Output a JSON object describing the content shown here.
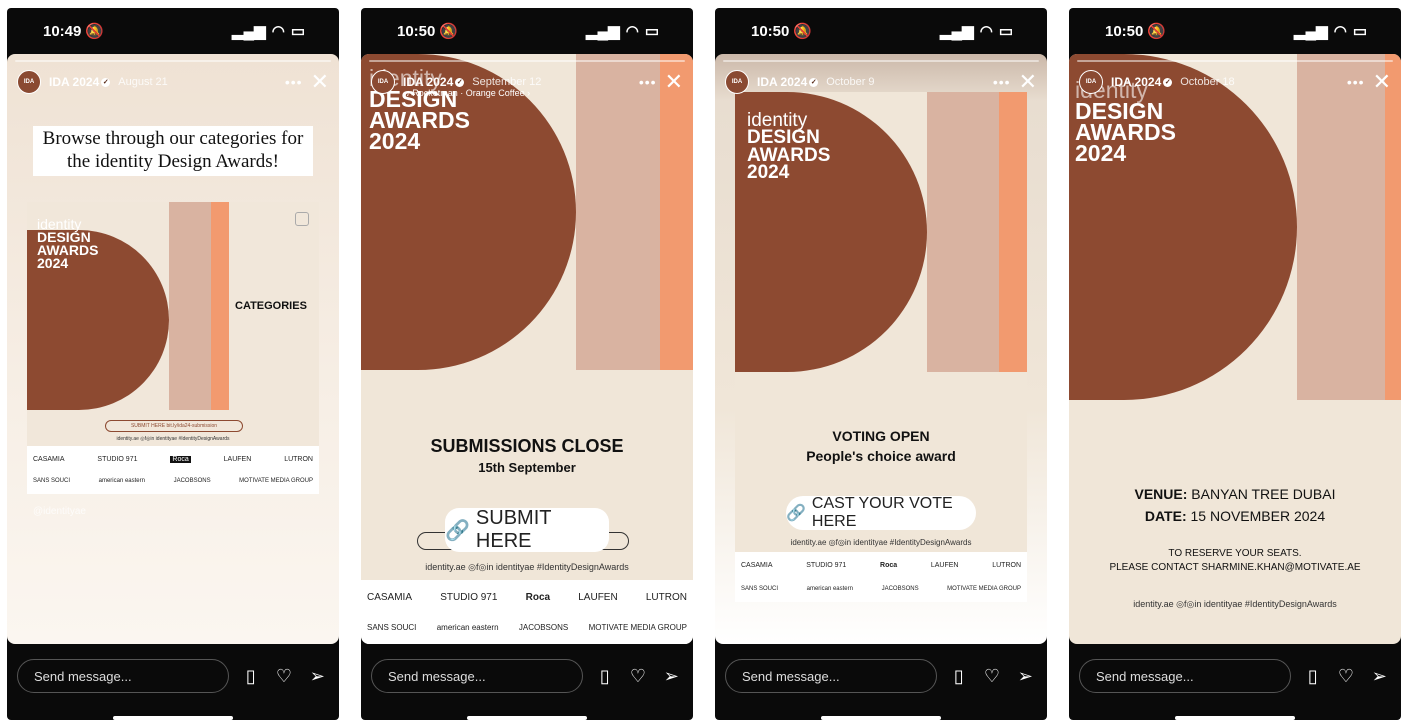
{
  "phones": [
    {
      "time": "10:49",
      "user": "IDA 2024",
      "date": "August 21",
      "caption": "Browse through our categories for the identity Design Awards!",
      "logo_id": "identity",
      "logo_lines": [
        "DESIGN",
        "AWARDS",
        "2024"
      ],
      "categories": "CATEGORIES",
      "submit_link": "SUBMIT HERE bit.ly/ida24-submission",
      "social": "identity.ae  ◎f◎in identityae  #IdentityDesignAwards",
      "watermark": "@identityae"
    },
    {
      "time": "10:50",
      "user": "IDA 2024",
      "date": "September 12",
      "music": "Rocketman · Orange Coffee",
      "logo_id": "identity",
      "logo_lines": [
        "DESIGN",
        "AWARDS",
        "2024"
      ],
      "headline": "SUBMISSIONS CLOSE",
      "subline": "15th September",
      "cta": "SUBMIT HERE",
      "social": "identity.ae  ◎f◎in identityae  #IdentityDesignAwards"
    },
    {
      "time": "10:50",
      "user": "IDA 2024",
      "date": "October 9",
      "logo_id": "identity",
      "logo_lines": [
        "DESIGN",
        "AWARDS",
        "2024"
      ],
      "headline": "VOTING OPEN",
      "subline": "People's choice award",
      "cta": "CAST YOUR VOTE HERE",
      "social": "identity.ae  ◎f◎in identityae  #IdentityDesignAwards"
    },
    {
      "time": "10:50",
      "user": "IDA 2024",
      "date": "October 18",
      "logo_id": "identity",
      "logo_lines": [
        "DESIGN",
        "AWARDS",
        "2024"
      ],
      "venue_label": "VENUE:",
      "venue": "BANYAN TREE DUBAI",
      "date_label": "DATE:",
      "event_date": "15 NOVEMBER 2024",
      "reserve1": "TO RESERVE YOUR SEATS.",
      "reserve2": "PLEASE CONTACT SHARMINE.KHAN@MOTIVATE.AE",
      "social": "identity.ae  ◎f◎in identityae  #IdentityDesignAwards"
    }
  ],
  "common": {
    "send_placeholder": "Send message...",
    "sponsors_row1": [
      "CASAMIA",
      "STUDIO 971",
      "Roca",
      "LAUFEN",
      "LUTRON"
    ],
    "sponsors_row2": [
      "SANS SOUCI",
      "american eastern",
      "JACOBSONS",
      "MOTIVATE MEDIA GROUP"
    ]
  },
  "colors": {
    "brown": "#8d4a31",
    "beige": "#f0e6d8",
    "peach": "#f29a6f",
    "blush": "#d9b3a1"
  }
}
